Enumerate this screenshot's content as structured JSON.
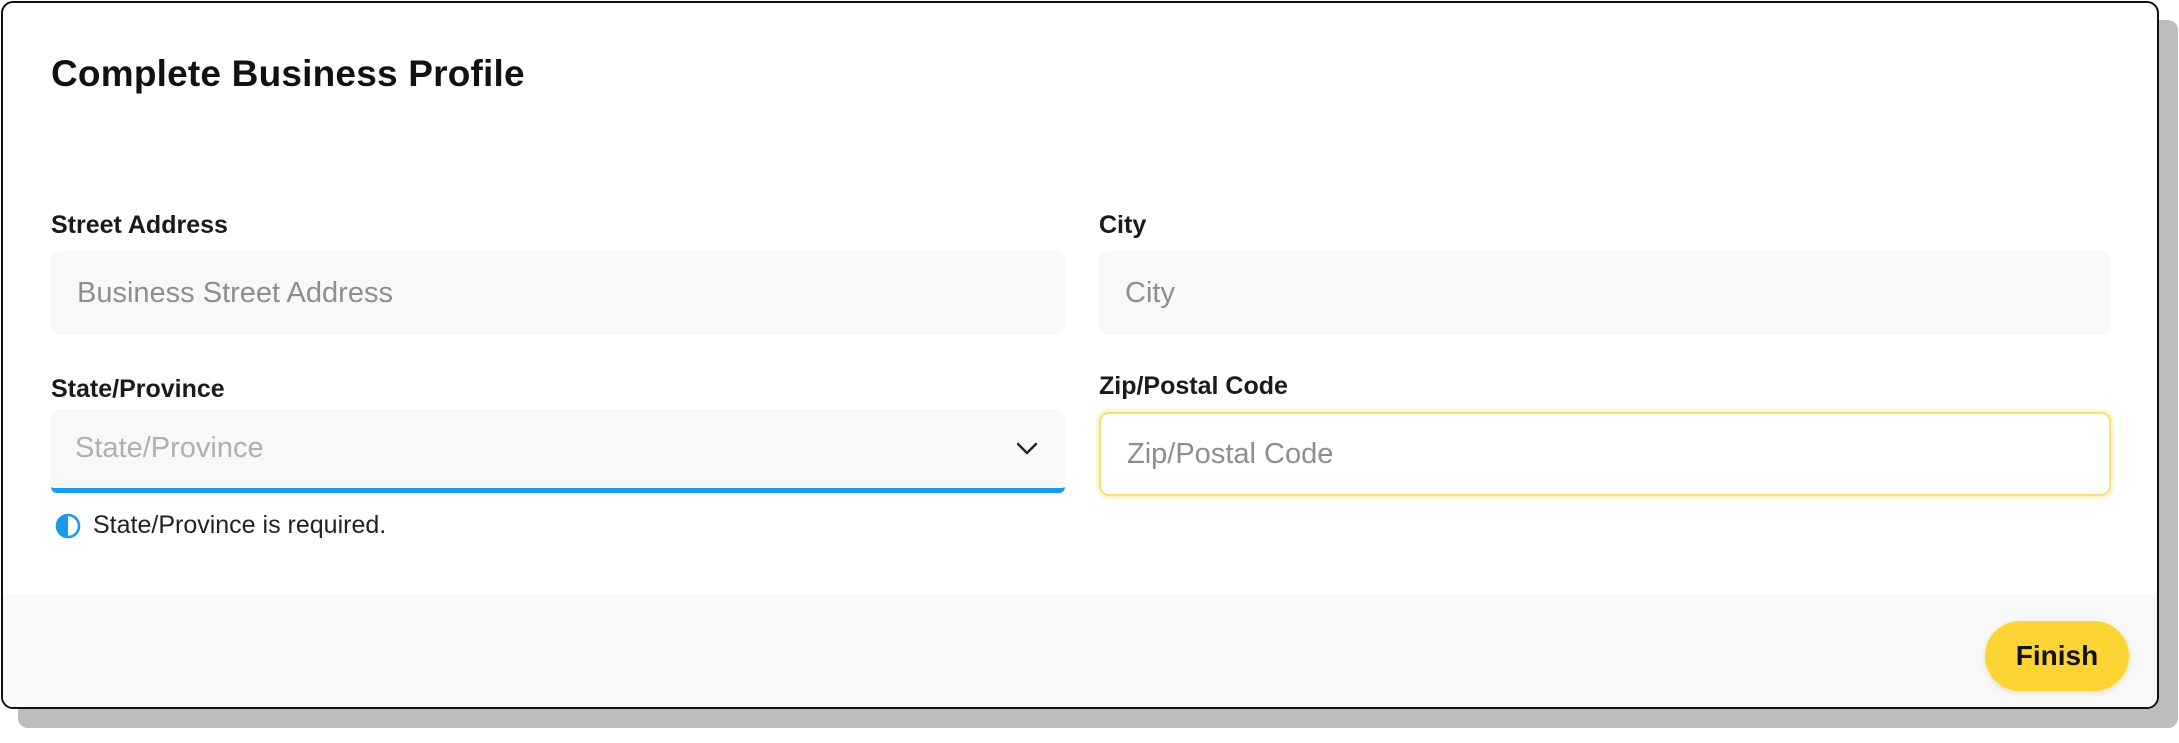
{
  "dialog": {
    "title": "Complete Business Profile"
  },
  "form": {
    "street": {
      "label": "Street Address",
      "placeholder": "Business Street Address"
    },
    "city": {
      "label": "City",
      "placeholder": "City"
    },
    "state": {
      "label": "State/Province",
      "placeholder": "State/Province",
      "error": "State/Province is required."
    },
    "zip": {
      "label": "Zip/Postal Code",
      "placeholder": "Zip/Postal Code"
    }
  },
  "footer": {
    "finish_label": "Finish"
  },
  "icons": {
    "dropdown": "chevron-down-icon",
    "error": "half-circle-info-icon"
  },
  "colors": {
    "accent_blue": "#1a9bea",
    "button_yellow": "#fcd535",
    "focus_yellow": "#f7df7a"
  }
}
